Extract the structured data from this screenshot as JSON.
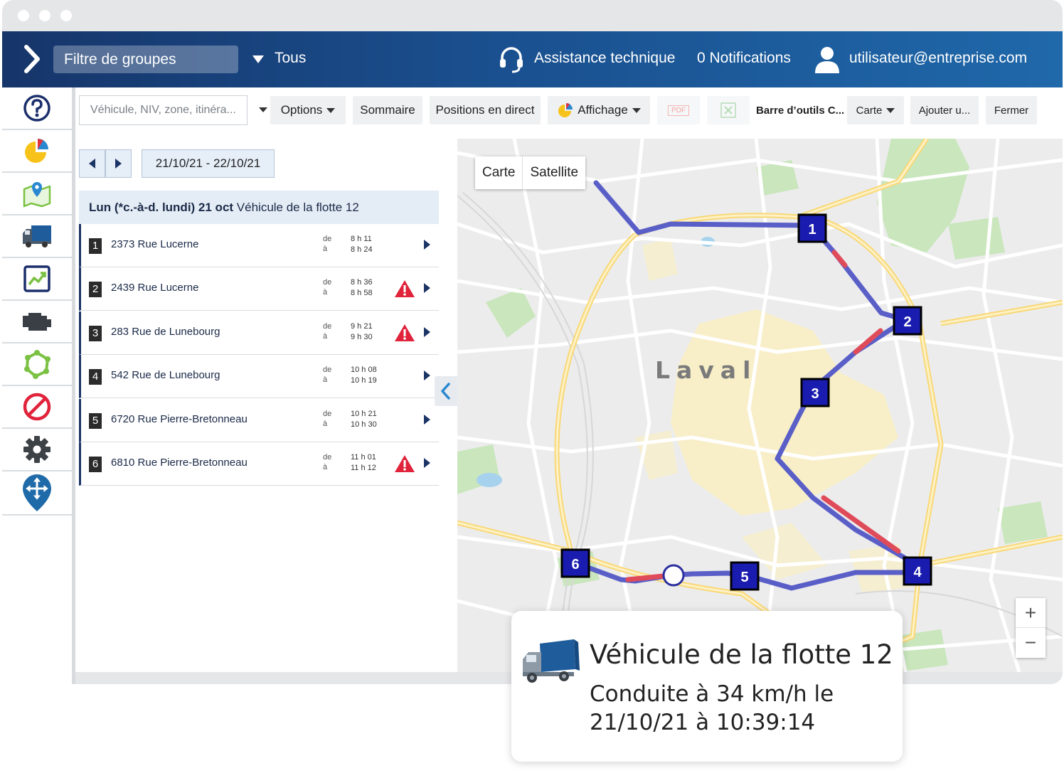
{
  "header": {
    "group_filter": "Filtre de groupes",
    "group_value": "Tous",
    "support": "Assistance technique",
    "notifications": "0 Notifications",
    "user": "utilisateur@entreprise.com"
  },
  "sidebar": {
    "items": [
      {
        "icon": "help-icon"
      },
      {
        "icon": "pie-chart-icon"
      },
      {
        "icon": "map-pin-icon"
      },
      {
        "icon": "truck-icon"
      },
      {
        "icon": "trend-chart-icon"
      },
      {
        "icon": "engine-icon"
      },
      {
        "icon": "zones-icon"
      },
      {
        "icon": "exceptions-icon"
      },
      {
        "icon": "gear-icon"
      },
      {
        "icon": "marketplace-icon"
      }
    ]
  },
  "toolbar": {
    "search_placeholder": "Véhicule, NIV, zone, itinéra...",
    "options": "Options",
    "summary": "Sommaire",
    "live": "Positions en direct",
    "display": "Affichage",
    "pdf": "PDF",
    "toolbar_label": "Barre d’outils C...",
    "map": "Carte",
    "add": "Ajouter u...",
    "close": "Fermer"
  },
  "trip": {
    "date_range": "21/10/21 - 22/10/21",
    "day_bold": "Lun (*c.-à-d. lundi) 21 oct",
    "vehicle": "Véhicule de la flotte 12",
    "from_label": "de",
    "to_label": "à",
    "stops": [
      {
        "num": "1",
        "address": "2373 Rue Lucerne",
        "from": "8 h 11",
        "to": "8 h 24",
        "warning": false
      },
      {
        "num": "2",
        "address": "2439 Rue Lucerne",
        "from": "8 h 36",
        "to": "8 h 58",
        "warning": true
      },
      {
        "num": "3",
        "address": "283 Rue de Lunebourg",
        "from": "9 h 21",
        "to": "9 h 30",
        "warning": true
      },
      {
        "num": "4",
        "address": "542 Rue de Lunebourg",
        "from": "10 h 08",
        "to": "10 h 19",
        "warning": false
      },
      {
        "num": "5",
        "address": "6720 Rue Pierre-Bretonneau",
        "from": "10 h 21",
        "to": "10 h 30",
        "warning": false
      },
      {
        "num": "6",
        "address": "6810 Rue Pierre-Bretonneau",
        "from": "11 h 01",
        "to": "11 h 12",
        "warning": true
      }
    ]
  },
  "map": {
    "type_map": "Carte",
    "type_satellite": "Satellite",
    "city": "Laval",
    "markers": [
      "1",
      "2",
      "3",
      "4",
      "5",
      "6"
    ],
    "zoom_in": "+",
    "zoom_out": "−",
    "route_color": "#5a5fc8",
    "speeding_color": "#e04b5a"
  },
  "info_card": {
    "title": "Véhicule de la flotte 12",
    "detail": "Conduite à 34 km/h le 21/10/21 à 10:39:14"
  }
}
